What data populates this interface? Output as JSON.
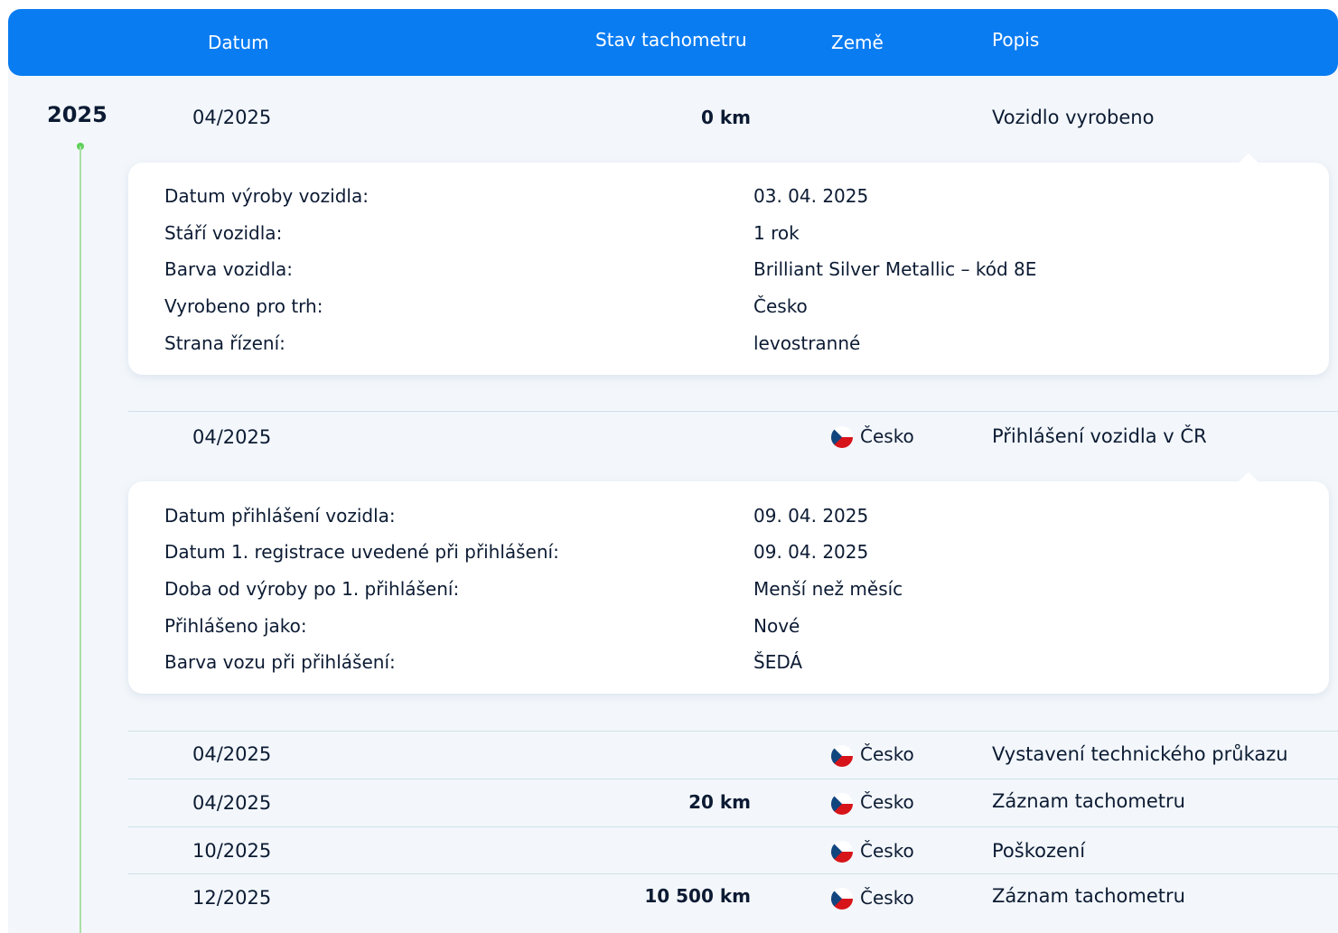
{
  "header": {
    "date": "Datum",
    "odometer": "Stav tachometru",
    "country": "Země",
    "description": "Popis"
  },
  "year": "2025",
  "colors": {
    "header": "#0a7cf2",
    "timeline": "#5fd15a",
    "flag_blue": "#11457e",
    "flag_red": "#d7141a"
  },
  "rows": [
    {
      "date": "04/2025",
      "odometer": "0 km",
      "country": "",
      "description": "Vozidlo vyrobeno",
      "details": [
        {
          "label": "Datum výroby vozidla:",
          "value": "03. 04. 2025"
        },
        {
          "label": "Stáří vozidla:",
          "value": "1 rok"
        },
        {
          "label": "Barva vozidla:",
          "value": "Brilliant Silver Metallic – kód 8E"
        },
        {
          "label": "Vyrobeno pro trh:",
          "value": "Česko"
        },
        {
          "label": "Strana řízení:",
          "value": "levostranné"
        }
      ]
    },
    {
      "date": "04/2025",
      "odometer": "",
      "country": "Česko",
      "description": "Přihlášení vozidla v ČR",
      "details": [
        {
          "label": "Datum přihlášení vozidla:",
          "value": "09. 04. 2025"
        },
        {
          "label": "Datum 1. registrace uvedené při přihlášení:",
          "value": "09. 04. 2025"
        },
        {
          "label": "Doba od výroby po 1. přihlášení:",
          "value": "Menší než měsíc"
        },
        {
          "label": "Přihlášeno jako:",
          "value": "Nové"
        },
        {
          "label": "Barva vozu při přihlášení:",
          "value": "ŠEDÁ"
        }
      ]
    },
    {
      "date": "04/2025",
      "odometer": "",
      "country": "Česko",
      "description": "Vystavení technického průkazu"
    },
    {
      "date": "04/2025",
      "odometer": "20 km",
      "country": "Česko",
      "description": "Záznam tachometru"
    },
    {
      "date": "10/2025",
      "odometer": "",
      "country": "Česko",
      "description": "Poškození"
    },
    {
      "date": "12/2025",
      "odometer": "10 500 km",
      "country": "Česko",
      "description": "Záznam tachometru"
    }
  ]
}
